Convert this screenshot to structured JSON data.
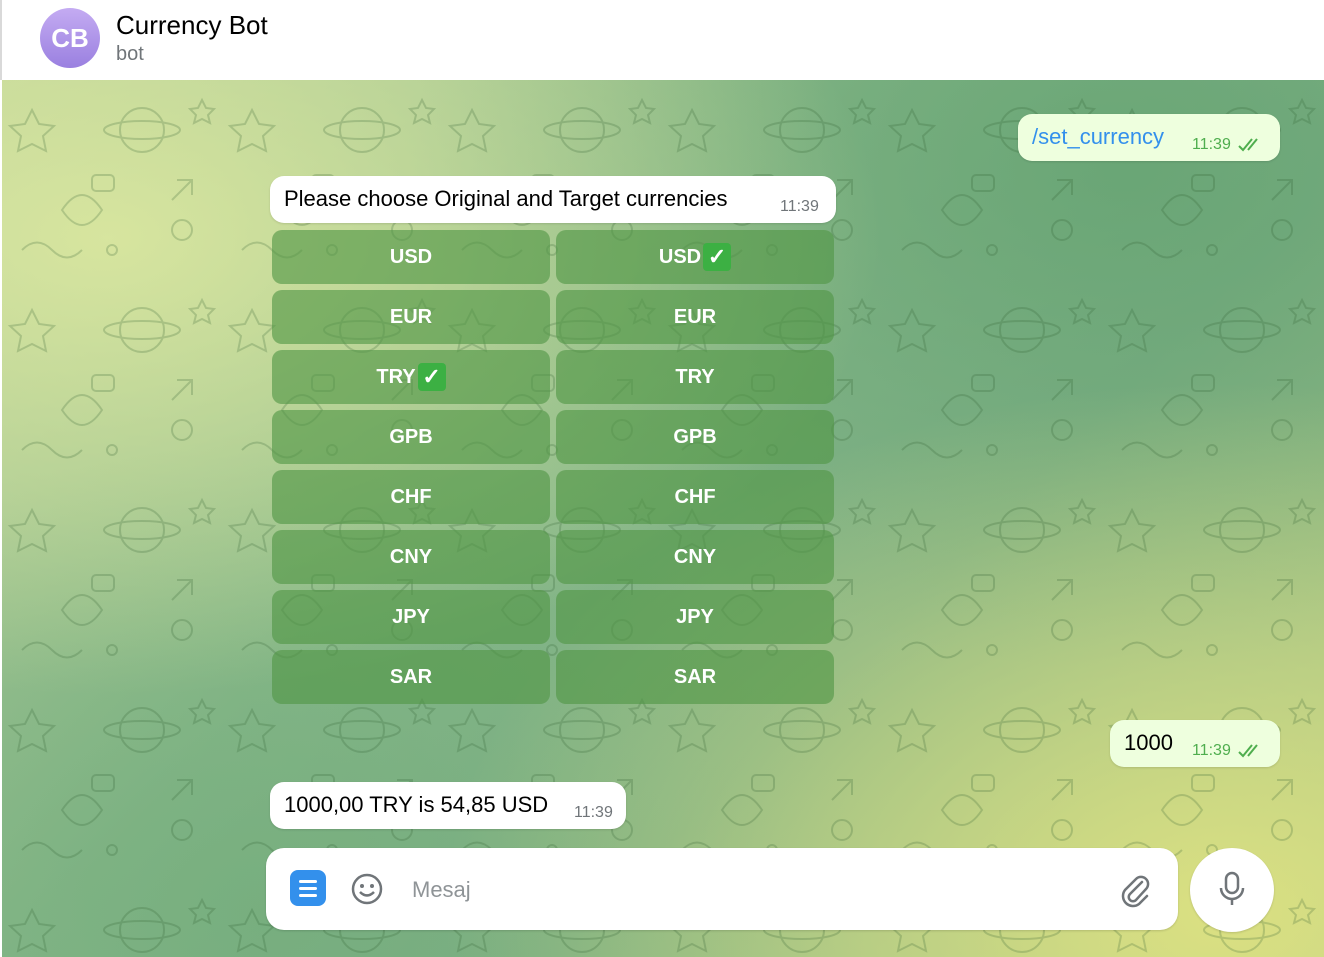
{
  "header": {
    "avatar_initials": "CB",
    "title": "Currency Bot",
    "subtitle": "bot"
  },
  "messages": {
    "cmd": {
      "text": "/set_currency",
      "time": "11:39"
    },
    "prompt": {
      "text": "Please choose Original and Target currencies",
      "time": "11:39"
    },
    "amount": {
      "text": "1000",
      "time": "11:39"
    },
    "result": {
      "text": "1000,00 TRY is 54,85 USD",
      "time": "11:39"
    }
  },
  "keyboard": {
    "original": [
      {
        "label": "USD",
        "checked": false
      },
      {
        "label": "EUR",
        "checked": false
      },
      {
        "label": "TRY",
        "checked": true
      },
      {
        "label": "GPB",
        "checked": false
      },
      {
        "label": "CHF",
        "checked": false
      },
      {
        "label": "CNY",
        "checked": false
      },
      {
        "label": "JPY",
        "checked": false
      },
      {
        "label": "SAR",
        "checked": false
      }
    ],
    "target": [
      {
        "label": "USD",
        "checked": true
      },
      {
        "label": "EUR",
        "checked": false
      },
      {
        "label": "TRY",
        "checked": false
      },
      {
        "label": "GPB",
        "checked": false
      },
      {
        "label": "CHF",
        "checked": false
      },
      {
        "label": "CNY",
        "checked": false
      },
      {
        "label": "JPY",
        "checked": false
      },
      {
        "label": "SAR",
        "checked": false
      }
    ]
  },
  "composer": {
    "placeholder": "Mesaj"
  },
  "icons": {
    "menu": "menu-icon",
    "emoji": "smile-icon",
    "attach": "paperclip-icon",
    "mic": "microphone-icon",
    "read": "double-check-icon"
  },
  "colors": {
    "accent": "#3390ec",
    "outgoing_bubble": "#eeffde",
    "read_tick": "#4fae4e",
    "keyboard_button": "#5a9b4e"
  }
}
